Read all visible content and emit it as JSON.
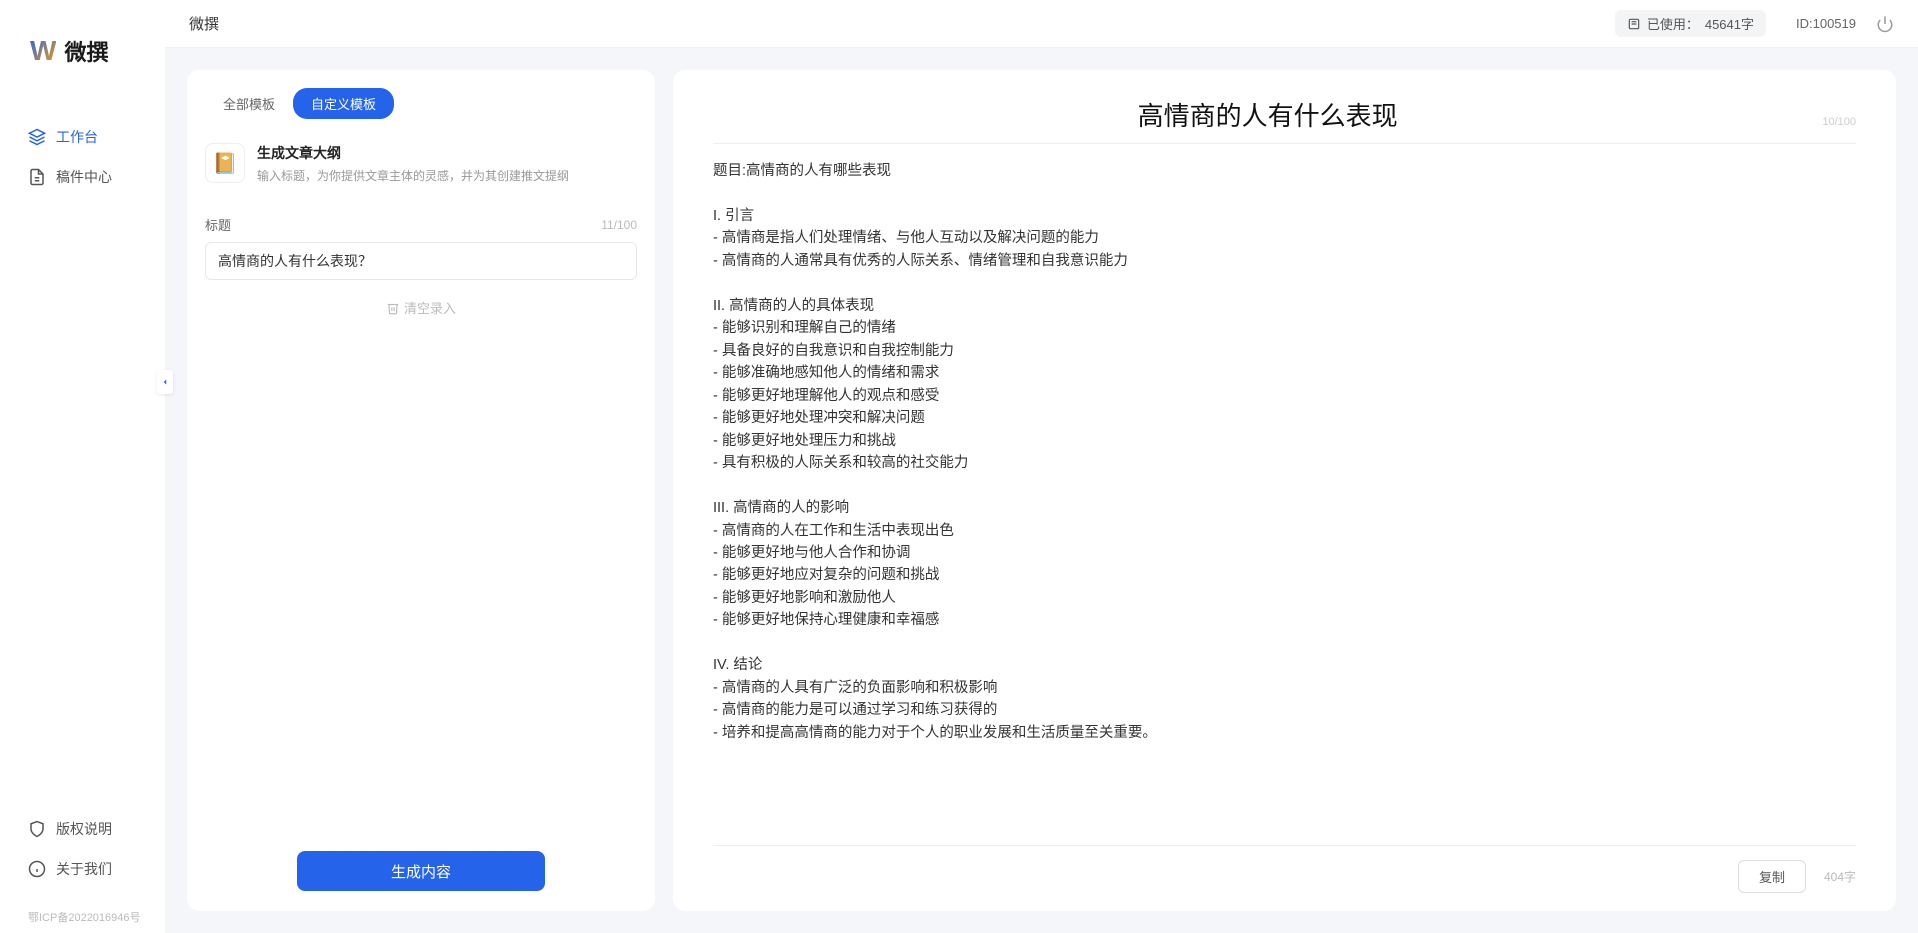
{
  "app": {
    "logo_text": "微撰",
    "title": "微撰"
  },
  "sidebar": {
    "items": [
      {
        "label": "工作台"
      },
      {
        "label": "稿件中心"
      }
    ],
    "bottom": [
      {
        "label": "版权说明"
      },
      {
        "label": "关于我们"
      }
    ],
    "footer": "鄂ICP备2022016946号"
  },
  "topbar": {
    "usage_prefix": "已使用：",
    "usage_value": "45641字",
    "id_label": "ID:100519"
  },
  "left_panel": {
    "tabs": [
      {
        "label": "全部模板"
      },
      {
        "label": "自定义模板"
      }
    ],
    "template": {
      "icon": "📔",
      "name": "生成文章大纲",
      "desc": "输入标题，为你提供文章主体的灵感，并为其创建推文提纲"
    },
    "field": {
      "label": "标题",
      "counter": "11/100",
      "value": "高情商的人有什么表现？"
    },
    "clear_label": "清空录入",
    "generate_label": "生成内容"
  },
  "right_panel": {
    "title": "高情商的人有什么表现",
    "title_counter": "10/100",
    "body": "题目:高情商的人有哪些表现\n\nI. 引言\n- 高情商是指人们处理情绪、与他人互动以及解决问题的能力\n- 高情商的人通常具有优秀的人际关系、情绪管理和自我意识能力\n\nII. 高情商的人的具体表现\n- 能够识别和理解自己的情绪\n- 具备良好的自我意识和自我控制能力\n- 能够准确地感知他人的情绪和需求\n- 能够更好地理解他人的观点和感受\n- 能够更好地处理冲突和解决问题\n- 能够更好地处理压力和挑战\n- 具有积极的人际关系和较高的社交能力\n\nIII. 高情商的人的影响\n- 高情商的人在工作和生活中表现出色\n- 能够更好地与他人合作和协调\n- 能够更好地应对复杂的问题和挑战\n- 能够更好地影响和激励他人\n- 能够更好地保持心理健康和幸福感\n\nIV. 结论\n- 高情商的人具有广泛的负面影响和积极影响\n- 高情商的能力是可以通过学习和练习获得的\n- 培养和提高高情商的能力对于个人的职业发展和生活质量至关重要。",
    "copy_label": "复制",
    "word_count": "404字"
  }
}
